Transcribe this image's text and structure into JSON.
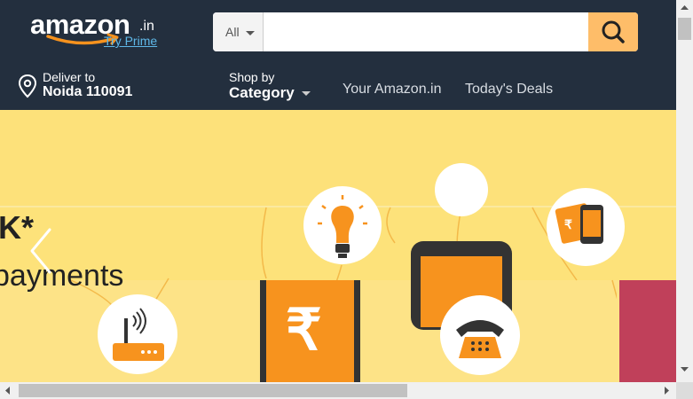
{
  "header": {
    "logo": {
      "wordmark": "amazon",
      "tld": ".in",
      "prime_link": "Try Prime"
    },
    "search": {
      "department": "All",
      "placeholder": "",
      "value": "",
      "button_icon": "search-icon",
      "button_color": "#febd69"
    }
  },
  "nav": {
    "deliver": {
      "line1": "Deliver to",
      "line2": "Noida 110091",
      "icon": "location-pin-icon"
    },
    "shop_by": {
      "line1": "Shop by",
      "line2": "Category"
    },
    "links": [
      "Your Amazon.in",
      "Today's Deals"
    ]
  },
  "banner": {
    "text_fragment_1": "K*",
    "text_fragment_2": "payments",
    "icons": [
      "bulb-icon",
      "mobile-bill-icon",
      "router-icon",
      "rupee-icon",
      "telephone-icon"
    ],
    "background_color": "#fde27a",
    "accent_color": "#f7931e"
  },
  "colors": {
    "header_bg": "#232f3e",
    "banner_bg": "#fde27a",
    "side_panel": "#c0405a"
  }
}
